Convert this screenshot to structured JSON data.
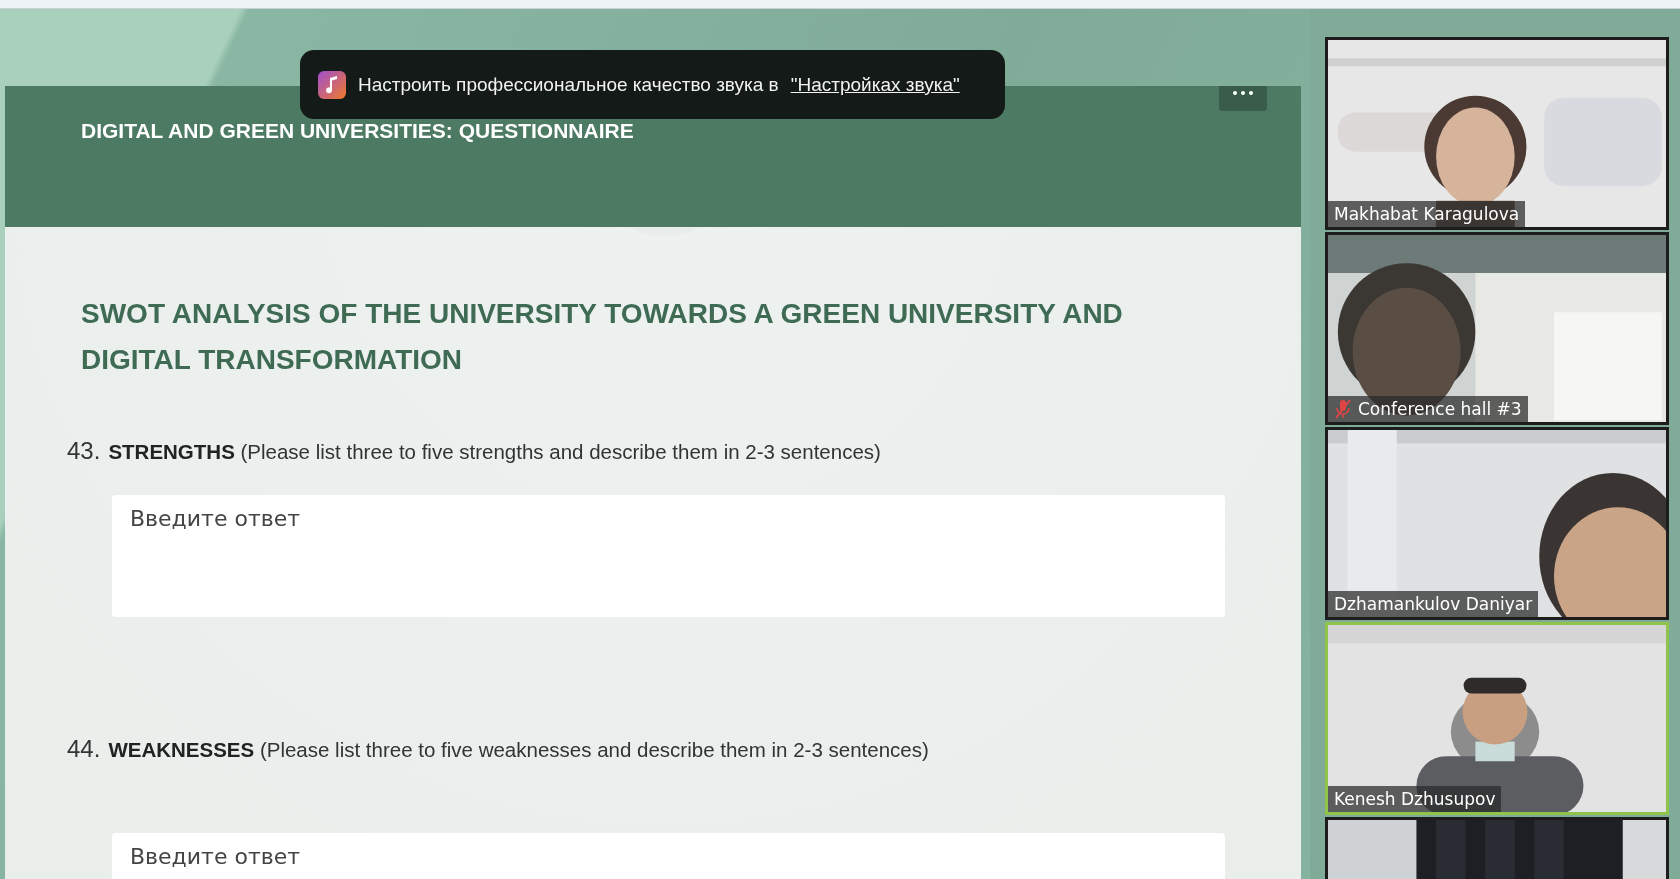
{
  "toast": {
    "text": "Настроить профессиональное качество звука в",
    "link": "\"Настройках звука\""
  },
  "form": {
    "title": "DIGITAL AND GREEN UNIVERSITIES: QUESTIONNAIRE",
    "section_title": "SWOT ANALYSIS OF THE UNIVERSITY TOWARDS A GREEN UNIVERSITY AND DIGITAL TRANSFORMATION",
    "questions": [
      {
        "number": "43.",
        "text": "**STRENGTHS** (Please list three to five strengths and describe them in 2-3 sentences)",
        "placeholder": "Введите ответ"
      },
      {
        "number": "44.",
        "text": "**WEAKNESSES** (Please list three to five weaknesses and describe them in 2-3 sentences)",
        "placeholder": "Введите ответ"
      }
    ]
  },
  "participants": [
    {
      "name": "Makhabat Karagulova",
      "active_speaker": false,
      "kind": "picture"
    },
    {
      "name": "Conference hall #3",
      "muted": true,
      "active_speaker": false,
      "kind": "picture"
    },
    {
      "name": "Dzhamankulov Daniyar",
      "active_speaker": false,
      "kind": "picture"
    },
    {
      "name": "Kenesh Dzhusupov",
      "active_speaker": true,
      "kind": "picture"
    },
    {
      "kind": "picture",
      "active_speaker": false
    }
  ]
}
